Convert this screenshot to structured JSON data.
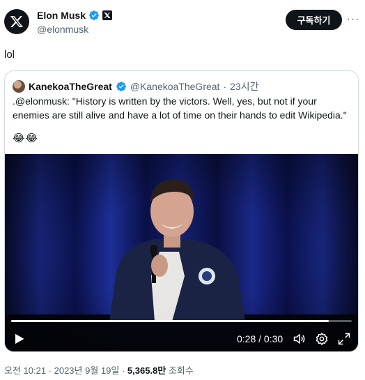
{
  "author": {
    "display_name": "Elon Musk",
    "handle": "@elonmusk",
    "avatar_icon": "x-logo-icon",
    "verified_icon": "verified-badge-icon",
    "affiliation_icon": "x-affiliation-badge-icon"
  },
  "actions": {
    "subscribe_label": "구독하기",
    "more_label": "···"
  },
  "tweet": {
    "text": "lol"
  },
  "quote": {
    "display_name": "KanekoaTheGreat",
    "handle": "@KanekoaTheGreat",
    "time": "23시간",
    "separator": "·",
    "body": ".@elonmusk: \"History is written by the victors. Well, yes, but not if your enemies are still alive and have a lot of time on their hands to edit Wikipedia.\"",
    "emoji": "😂😂"
  },
  "video": {
    "time_label": "0:28 / 0:30",
    "progress": 0.933,
    "play_icon": "play-icon",
    "volume_icon": "volume-icon",
    "settings_icon": "gear-icon",
    "fullscreen_icon": "fullscreen-icon"
  },
  "meta": {
    "timestamp": "오전 10:21 · 2023년 9월 19일 · ",
    "views_count": "5,365.8만",
    "views_label": " 조회수"
  },
  "colors": {
    "text_primary": "#0f1419",
    "text_secondary": "#536471",
    "verified_blue": "#1d9bf0",
    "border": "#cfd9de"
  }
}
